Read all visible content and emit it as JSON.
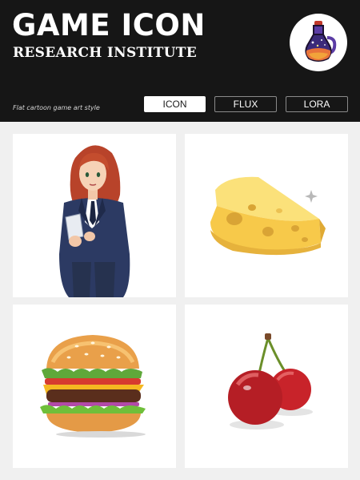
{
  "header": {
    "title": "GAME ICON",
    "subtitle": "RESEARCH INSTITUTE",
    "tagline": "Flat cartoon game art style",
    "logo_icon": "potion-bottle-icon"
  },
  "tabs": [
    {
      "label": "ICON",
      "active": true
    },
    {
      "label": "FLUX",
      "active": false
    },
    {
      "label": "LORA",
      "active": false
    }
  ],
  "gallery": [
    {
      "icon": "businesswoman-icon"
    },
    {
      "icon": "cheese-wedge-icon"
    },
    {
      "icon": "burger-icon"
    },
    {
      "icon": "cherries-icon"
    }
  ],
  "colors": {
    "header_bg": "#161616",
    "page_bg": "#f0f0f0",
    "card_bg": "#ffffff",
    "potion_purple": "#4b2a8c"
  }
}
